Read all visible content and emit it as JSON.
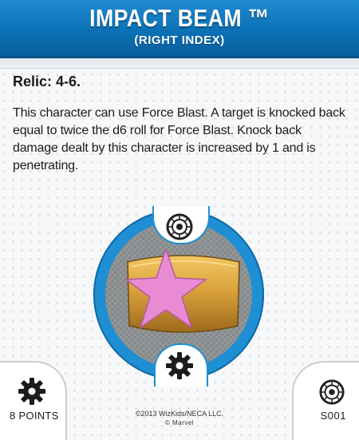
{
  "card": {
    "title": "IMPACT BEAM ™",
    "subtitle": "(RIGHT INDEX)",
    "relic": "Relic: 4-6.",
    "description": "This character can use Force Blast.  A target is knocked back equal to twice the d6 roll for Force Blast.  Knock back damage dealt by this character is increased by 1 and is penetrating.",
    "points": "8 POINTS",
    "code": "S001",
    "copyright": "©2013 WizKids/NECA LLC.",
    "copyright_marvel": "© Marvel"
  },
  "icons": {
    "top": "relic-ring-icon",
    "bottom": "gear-icon",
    "corner_left": "gear-icon",
    "corner_right": "relic-ring-icon",
    "art": "star-band-icon"
  },
  "colors": {
    "header_blue": "#0a6fb4",
    "badge_blue": "#1e8fd3",
    "band_gold": "#d9a23c",
    "star_pink": "#e98bd2"
  }
}
